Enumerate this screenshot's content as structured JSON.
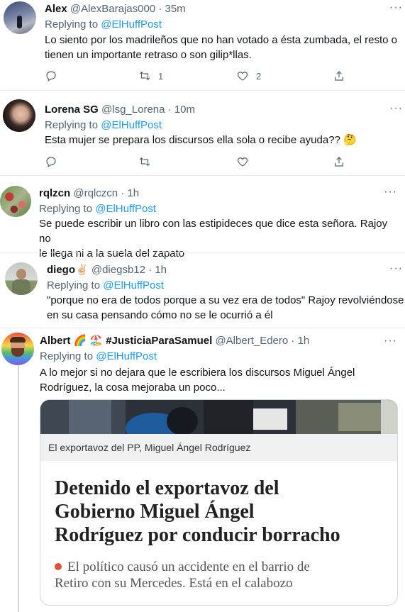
{
  "tweets": [
    {
      "name": "Alex",
      "handle": "@AlexBarajas000",
      "time": "· 35m",
      "replying_prefix": "Replying to",
      "replying_to": "@ElHuffPost",
      "text_lines": [
        "Lo siento por los madrileños que no han votado a ésta zumbada, el resto o",
        "tienen un importante retraso o son gilip*llas."
      ],
      "retweets": "1",
      "likes": "2"
    },
    {
      "name": "Lorena SG",
      "handle": "@lsg_Lorena",
      "time": "· 10m",
      "replying_prefix": "Replying to",
      "replying_to": "@ElHuffPost",
      "text_lines": [
        "Esta mujer se prepara los discursos ella sola o recibe ayuda?? 🤔"
      ],
      "retweets": "",
      "likes": ""
    },
    {
      "name": "rqlzcn",
      "handle": "@rqlczcn",
      "time": "· 1h",
      "replying_prefix": "Replying to",
      "replying_to": "@ElHuffPost",
      "text_lines": [
        "Se puede escribir un libro con las estipideces que dice esta señora. Rajoy no",
        "le llega ni a la suela del zapato"
      ]
    },
    {
      "name": "diego✌🏻",
      "handle": "@diegsb12",
      "time": "· 1h",
      "replying_prefix": "Replying to",
      "replying_to": "@ElHuffPost",
      "text_lines": [
        "\"porque no era de todos porque a su vez era de todos\" Rajoy revolviéndose",
        "en su casa pensando cómo no se le ocurrió a él"
      ]
    },
    {
      "name": "Albert 🌈 🏖️ #JusticiaParaSamuel",
      "handle": "@Albert_Edero",
      "time": "· 1h",
      "replying_prefix": "Replying to",
      "replying_to": "@ElHuffPost",
      "text_lines": [
        "A lo mejor si no dejara que le escribiera los discursos Miguel Ángel",
        "Rodríguez, la cosa mejoraba un poco..."
      ]
    }
  ],
  "card": {
    "caption": "El exportavoz del PP, Miguel Ángel Rodríguez",
    "headline_lines": [
      "Detenido el exportavoz del",
      "Gobierno Miguel Ángel",
      "Rodríguez por conducir borracho"
    ],
    "subhead_lines": [
      "El político causó un accidente en el barrio de",
      "Retiro con su Mercedes. Está en el calabozo"
    ]
  },
  "more_glyph": "···"
}
